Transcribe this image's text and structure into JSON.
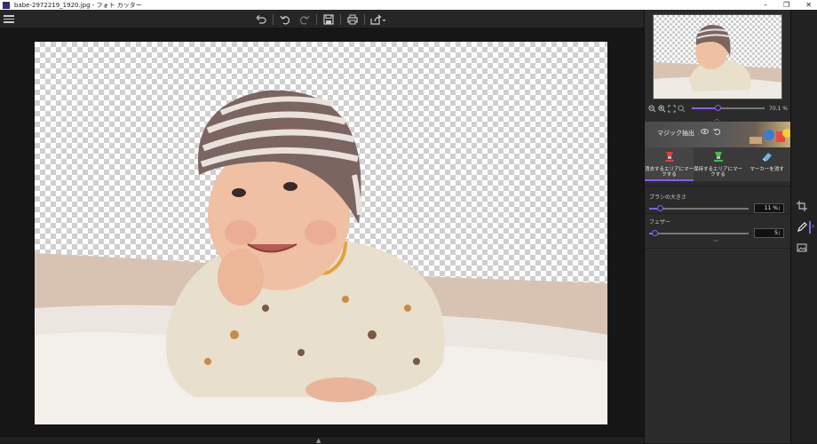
{
  "window": {
    "title": "babe-2972219_1920.jpg - フォト カッター",
    "controls": [
      "–",
      "❐",
      "✕"
    ]
  },
  "toolbar": {
    "items": [
      "menu-icon",
      "undo-history-icon",
      "undo-icon",
      "redo-icon",
      "save-icon",
      "print-icon",
      "share-icon"
    ]
  },
  "navigator": {
    "zoom_label": "70.1 %",
    "zoom_fraction": 0.35
  },
  "magic": {
    "label": "マジック抽出",
    "icons": [
      "eye-icon",
      "undo-icon"
    ]
  },
  "tools": [
    {
      "label": "消去するエリアにマークする",
      "icon": "red-marker-icon"
    },
    {
      "label": "保持するエリアにマークする",
      "icon": "green-marker-icon"
    },
    {
      "label": "マーカーを消す",
      "icon": "eraser-icon"
    }
  ],
  "params": {
    "brush": {
      "label": "ブラシの大きさ",
      "value": "11 %",
      "fraction": 0.11
    },
    "feather": {
      "label": "フェザー",
      "value": "5",
      "fraction": 0.05
    }
  },
  "rail": {
    "icons": [
      "crop-icon",
      "pen-icon",
      "image-icon"
    ],
    "arrow": "›"
  },
  "colors": {
    "accent": "#8b5cf6",
    "panel": "#2b2b2b",
    "canvas_bg": "#161616"
  }
}
